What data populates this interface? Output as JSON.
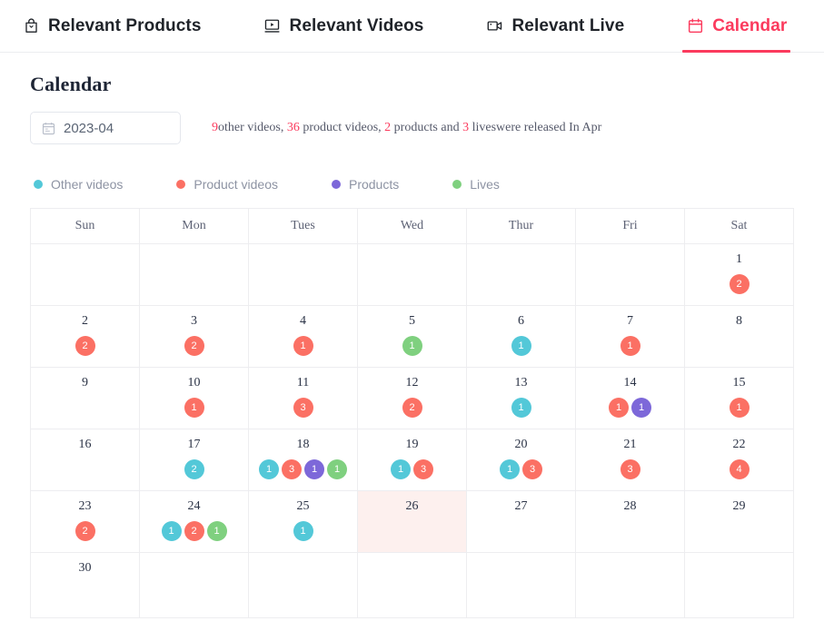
{
  "tabs": [
    {
      "label": "Relevant Products",
      "icon": "shopping-bag-icon",
      "active": false
    },
    {
      "label": "Relevant Videos",
      "icon": "monitor-play-icon",
      "active": false
    },
    {
      "label": "Relevant Live",
      "icon": "video-camera-icon",
      "active": false
    },
    {
      "label": "Calendar",
      "icon": "calendar-icon",
      "active": true
    }
  ],
  "page": {
    "title": "Calendar",
    "accent_color": "#fb3a5d"
  },
  "datepicker": {
    "value": "2023-04",
    "icon": "calendar-icon"
  },
  "summary": {
    "other_videos_count": "9",
    "other_videos_text": "other videos, ",
    "product_videos_count": "36",
    "product_videos_text": " product videos, ",
    "products_count": "2",
    "products_text": " products and ",
    "lives_count": "3",
    "tail_text": " liveswere released In Apr"
  },
  "legend": [
    {
      "label": "Other videos",
      "color": "#53c8d8",
      "key": "other"
    },
    {
      "label": "Product videos",
      "color": "#fb7064",
      "key": "product"
    },
    {
      "label": "Products",
      "color": "#7d68d9",
      "key": "goods"
    },
    {
      "label": "Lives",
      "color": "#7fd07f",
      "key": "live"
    }
  ],
  "calendar": {
    "weekday_headers": [
      "Sun",
      "Mon",
      "Tues",
      "Wed",
      "Thur",
      "Fri",
      "Sat"
    ],
    "today": 26,
    "weeks": [
      [
        {
          "day": "",
          "badges": []
        },
        {
          "day": "",
          "badges": []
        },
        {
          "day": "",
          "badges": []
        },
        {
          "day": "",
          "badges": []
        },
        {
          "day": "",
          "badges": []
        },
        {
          "day": "",
          "badges": []
        },
        {
          "day": "1",
          "badges": [
            {
              "type": "product",
              "count": "2"
            }
          ]
        }
      ],
      [
        {
          "day": "2",
          "badges": [
            {
              "type": "product",
              "count": "2"
            }
          ]
        },
        {
          "day": "3",
          "badges": [
            {
              "type": "product",
              "count": "2"
            }
          ]
        },
        {
          "day": "4",
          "badges": [
            {
              "type": "product",
              "count": "1"
            }
          ]
        },
        {
          "day": "5",
          "badges": [
            {
              "type": "live",
              "count": "1"
            }
          ]
        },
        {
          "day": "6",
          "badges": [
            {
              "type": "other",
              "count": "1"
            }
          ]
        },
        {
          "day": "7",
          "badges": [
            {
              "type": "product",
              "count": "1"
            }
          ]
        },
        {
          "day": "8",
          "badges": []
        }
      ],
      [
        {
          "day": "9",
          "badges": []
        },
        {
          "day": "10",
          "badges": [
            {
              "type": "product",
              "count": "1"
            }
          ]
        },
        {
          "day": "11",
          "badges": [
            {
              "type": "product",
              "count": "3"
            }
          ]
        },
        {
          "day": "12",
          "badges": [
            {
              "type": "product",
              "count": "2"
            }
          ]
        },
        {
          "day": "13",
          "badges": [
            {
              "type": "other",
              "count": "1"
            }
          ]
        },
        {
          "day": "14",
          "badges": [
            {
              "type": "product",
              "count": "1"
            },
            {
              "type": "goods",
              "count": "1"
            }
          ]
        },
        {
          "day": "15",
          "badges": [
            {
              "type": "product",
              "count": "1"
            }
          ]
        }
      ],
      [
        {
          "day": "16",
          "badges": []
        },
        {
          "day": "17",
          "badges": [
            {
              "type": "other",
              "count": "2"
            }
          ]
        },
        {
          "day": "18",
          "badges": [
            {
              "type": "other",
              "count": "1"
            },
            {
              "type": "product",
              "count": "3"
            },
            {
              "type": "goods",
              "count": "1"
            },
            {
              "type": "live",
              "count": "1"
            }
          ]
        },
        {
          "day": "19",
          "badges": [
            {
              "type": "other",
              "count": "1"
            },
            {
              "type": "product",
              "count": "3"
            }
          ]
        },
        {
          "day": "20",
          "badges": [
            {
              "type": "other",
              "count": "1"
            },
            {
              "type": "product",
              "count": "3"
            }
          ]
        },
        {
          "day": "21",
          "badges": [
            {
              "type": "product",
              "count": "3"
            }
          ]
        },
        {
          "day": "22",
          "badges": [
            {
              "type": "product",
              "count": "4"
            }
          ]
        }
      ],
      [
        {
          "day": "23",
          "badges": [
            {
              "type": "product",
              "count": "2"
            }
          ]
        },
        {
          "day": "24",
          "badges": [
            {
              "type": "other",
              "count": "1"
            },
            {
              "type": "product",
              "count": "2"
            },
            {
              "type": "live",
              "count": "1"
            }
          ]
        },
        {
          "day": "25",
          "badges": [
            {
              "type": "other",
              "count": "1"
            }
          ]
        },
        {
          "day": "26",
          "badges": []
        },
        {
          "day": "27",
          "badges": []
        },
        {
          "day": "28",
          "badges": []
        },
        {
          "day": "29",
          "badges": []
        }
      ],
      [
        {
          "day": "30",
          "badges": []
        },
        {
          "day": "",
          "badges": []
        },
        {
          "day": "",
          "badges": []
        },
        {
          "day": "",
          "badges": []
        },
        {
          "day": "",
          "badges": []
        },
        {
          "day": "",
          "badges": []
        },
        {
          "day": "",
          "badges": []
        }
      ]
    ]
  }
}
